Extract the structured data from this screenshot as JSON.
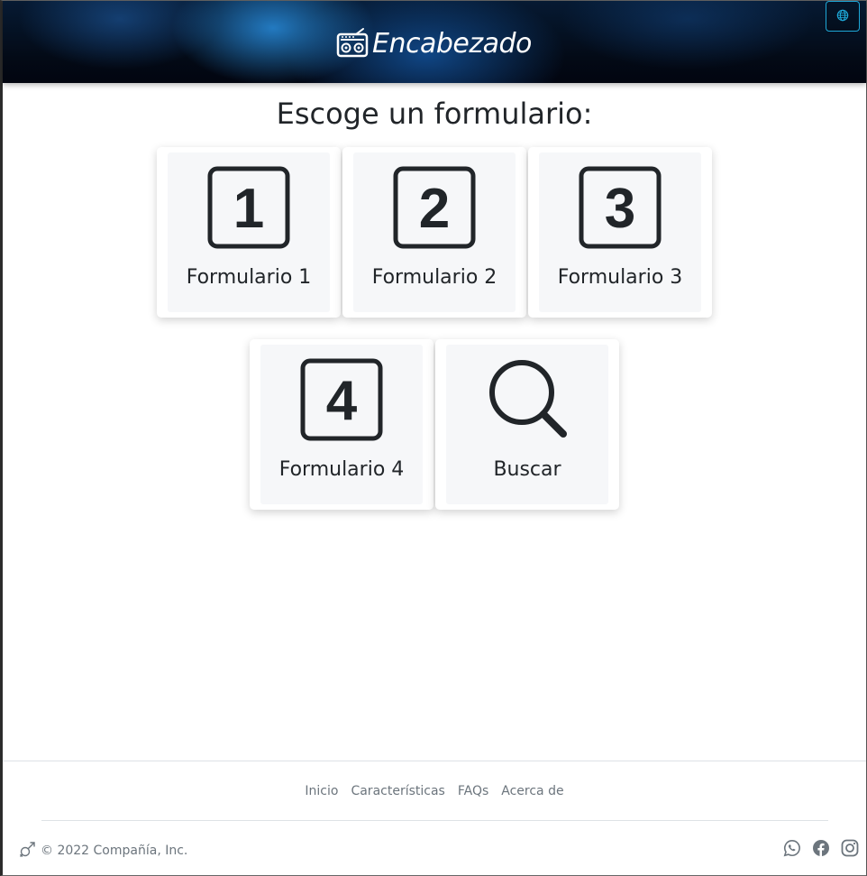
{
  "header": {
    "brand_text": "Encabezado",
    "brand_icon": "radio-icon",
    "language_icon": "globe-icon",
    "accent": "#1ea7d6"
  },
  "main": {
    "title": "Escoge un formulario:",
    "cards": [
      {
        "label": "Formulario 1",
        "icon": "square-1-icon",
        "digit": "1"
      },
      {
        "label": "Formulario 2",
        "icon": "square-2-icon",
        "digit": "2"
      },
      {
        "label": "Formulario 3",
        "icon": "square-3-icon",
        "digit": "3"
      },
      {
        "label": "Formulario 4",
        "icon": "square-4-icon",
        "digit": "4"
      },
      {
        "label": "Buscar",
        "icon": "search-icon"
      }
    ]
  },
  "footer": {
    "nav": [
      "Inicio",
      "Características",
      "FAQs",
      "Acerca de"
    ],
    "copyright": "© 2022 Compañía, Inc.",
    "logo_icon": "gender-symbol-icon",
    "social": [
      "whatsapp-icon",
      "facebook-icon",
      "instagram-icon"
    ]
  }
}
